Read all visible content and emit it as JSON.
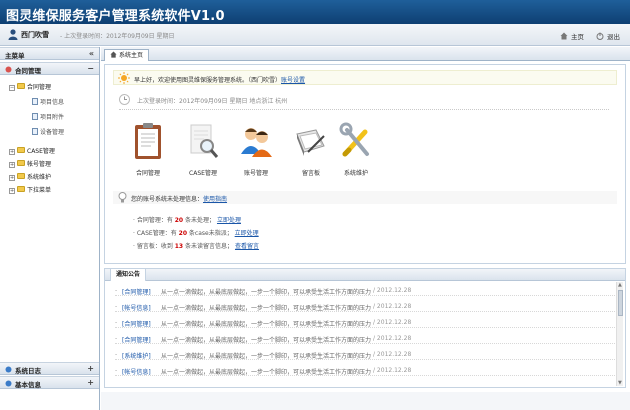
{
  "header": {
    "title": "图灵维保服务客户管理系统软件V1.0"
  },
  "userbar": {
    "username": "西门吹雪",
    "last_login": "- 上次登录时间：2012年09月09日 星期日",
    "home": "主页",
    "exit": "退出"
  },
  "sidebar": {
    "title": "主菜单",
    "collapse": "«",
    "group1": {
      "label": "合同管理",
      "ctl": "−"
    },
    "tree": {
      "contract": "合同管理",
      "leaves": [
        "项目信息",
        "项目附件",
        "设备管理"
      ],
      "case": "CASE管理",
      "account": "帐号管理",
      "system": "系统维护",
      "download": "下拉菜单"
    },
    "bottom": [
      {
        "label": "系统日志",
        "ctl": "+"
      },
      {
        "label": "基本信息",
        "ctl": "+"
      }
    ]
  },
  "tab": {
    "label": "系统主页"
  },
  "welcome": {
    "text": "早上好，欢迎使用图灵维保服务管理系统。（西门吹雪）",
    "link": "账号设置"
  },
  "login_info": "上次登录时间：2012年09月09日  星期日      地点浙江 杭州",
  "modules": [
    "合同管理",
    "CASE管理",
    "账号管理",
    "留言板",
    "系统维护"
  ],
  "notice": {
    "text": "您的账号系统未处理信息：",
    "link": "使用指南"
  },
  "todos": [
    {
      "prefix": "· 合同管理：有",
      "num": "20",
      "suffix": "条未处理；",
      "link": "立即处理"
    },
    {
      "prefix": "· CASE管理：有",
      "num": "20",
      "suffix": "条case未指派；",
      "link": "立即处理"
    },
    {
      "prefix": "· 留言板：收到",
      "num": "13",
      "suffix": "条未读留言信息；",
      "link": "查看留言"
    }
  ],
  "announcements": {
    "title": "通知公告",
    "rows": [
      {
        "cat": "[合同管理]",
        "text": "从一点一滴做起，从最底层做起，一步一个脚印，可以承受生活工作方面的压力",
        "date": "/ 2012.12.28"
      },
      {
        "cat": "[帐号信息]",
        "text": "从一点一滴做起，从最底层做起，一步一个脚印，可以承受生活工作方面的压力",
        "date": "/ 2012.12.28"
      },
      {
        "cat": "[合同管理]",
        "text": "从一点一滴做起，从最底层做起，一步一个脚印，可以承受生活工作方面的压力",
        "date": "/ 2012.12.28"
      },
      {
        "cat": "[合同管理]",
        "text": "从一点一滴做起，从最底层做起，一步一个脚印，可以承受生活工作方面的压力",
        "date": "/ 2012.12.28"
      },
      {
        "cat": "[系统维护]",
        "text": "从一点一滴做起，从最底层做起，一步一个脚印，可以承受生活工作方面的压力",
        "date": "/ 2012.12.28"
      },
      {
        "cat": "[帐号信息]",
        "text": "从一点一滴做起，从最底层做起，一步一个脚印，可以承受生活工作方面的压力",
        "date": "/ 2012.12.28"
      }
    ]
  }
}
